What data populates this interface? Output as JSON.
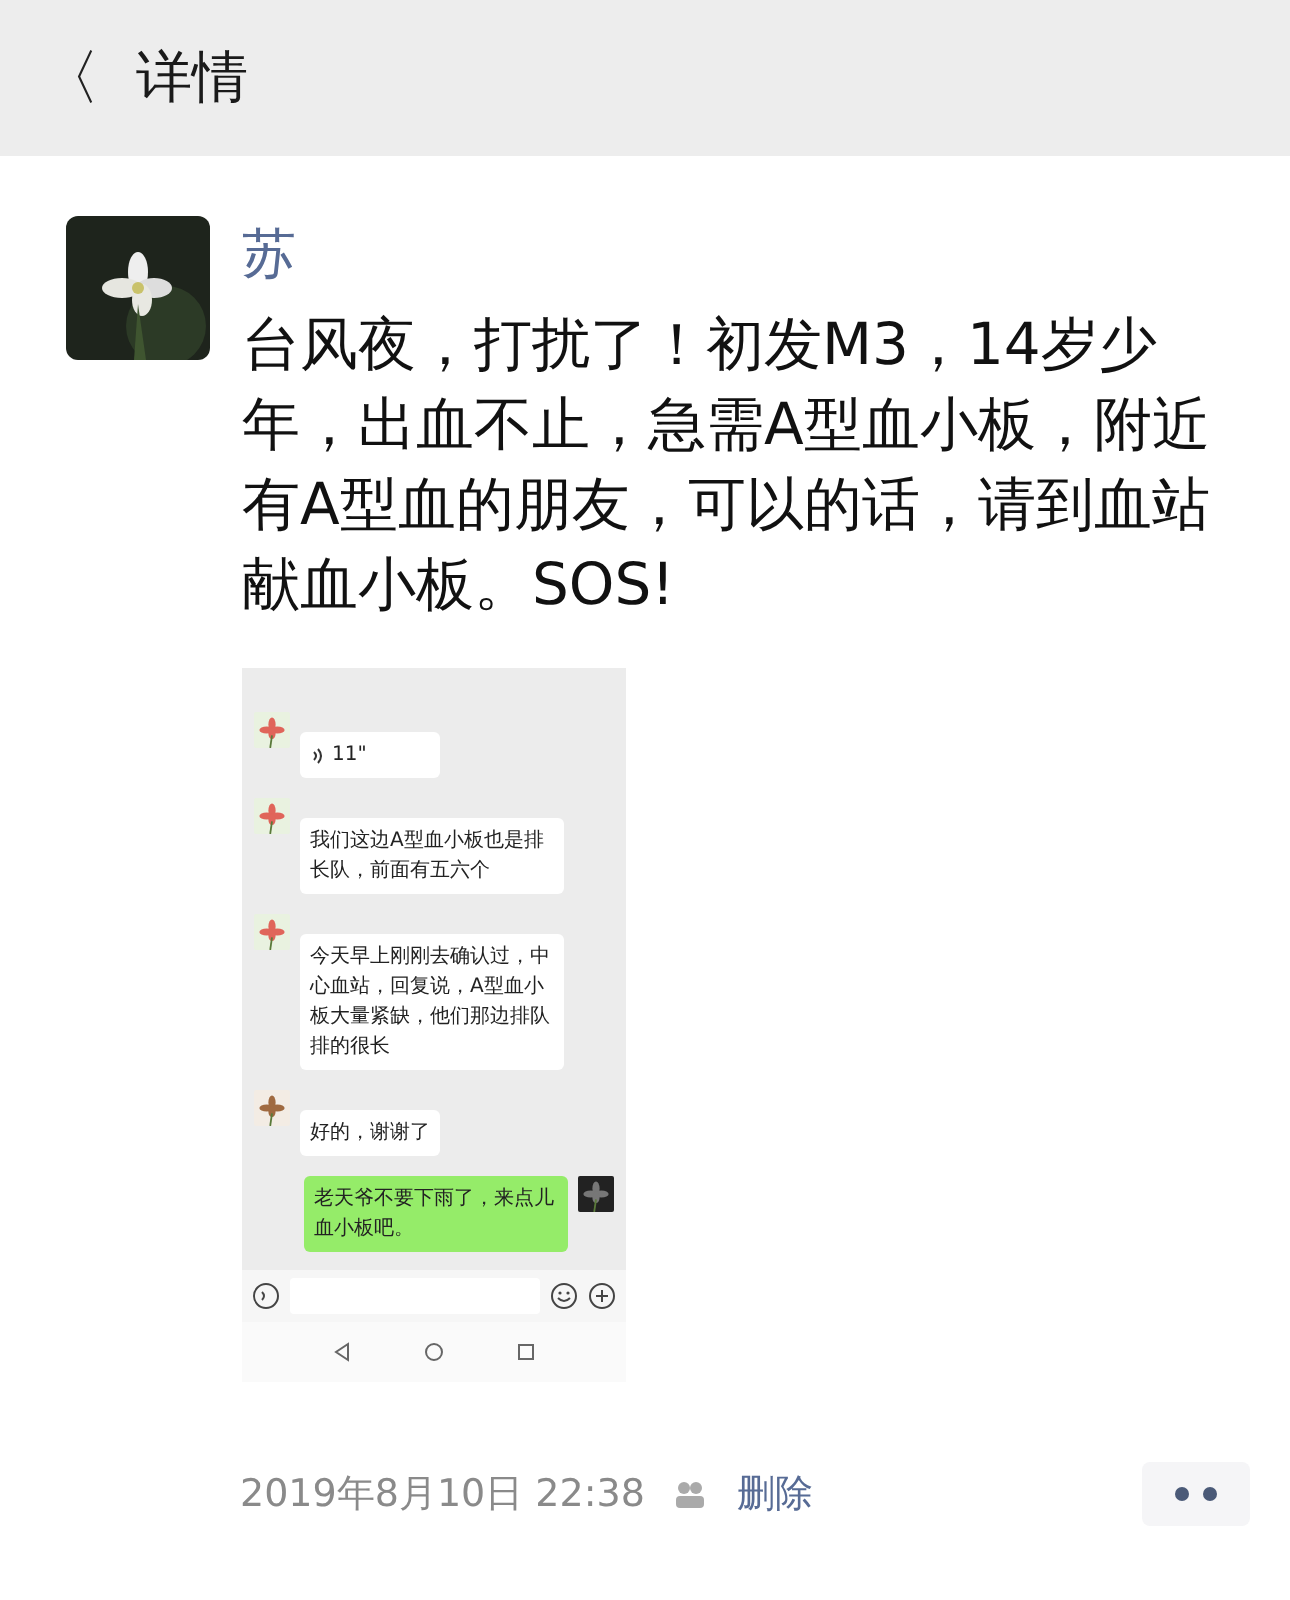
{
  "header": {
    "back": "〈",
    "title": "详情"
  },
  "post": {
    "author": "苏",
    "text": "台风夜，打扰了！初发M3，14岁少年，出血不止，急需A型血小板，附近有A型血的朋友，可以的话，请到血站献血小板。SOS!",
    "screenshot": {
      "messages": [
        {
          "kind": "voice",
          "mine": false,
          "text": "11\""
        },
        {
          "kind": "text",
          "mine": false,
          "text": "我们这边A型血小板也是排长队，前面有五六个"
        },
        {
          "kind": "text",
          "mine": false,
          "text": "今天早上刚刚去确认过，中心血站，回复说，A型血小板大量紧缺，他们那边排队排的很长"
        },
        {
          "kind": "text",
          "mine": false,
          "text": "好的，谢谢了"
        },
        {
          "kind": "text",
          "mine": true,
          "text": "老天爷不要下雨了，来点儿血小板吧。"
        }
      ]
    },
    "time": "2019年8月10日 22:38",
    "delete": "删除"
  }
}
